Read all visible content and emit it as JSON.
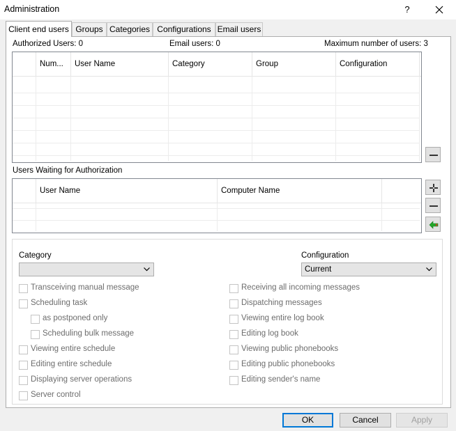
{
  "window": {
    "title": "Administration",
    "help_label": "?"
  },
  "tabs": [
    {
      "label": "Client end users",
      "active": true
    },
    {
      "label": "Groups",
      "active": false
    },
    {
      "label": "Categories",
      "active": false
    },
    {
      "label": "Configurations",
      "active": false
    },
    {
      "label": "Email users",
      "active": false
    }
  ],
  "stats": {
    "authorized_users": "Authorized Users: 0",
    "email_users": "Email users: 0",
    "max_users": "Maximum number of users: 3"
  },
  "users_table": {
    "columns": [
      "Num...",
      "User Name",
      "Category",
      "Group",
      "Configuration"
    ],
    "rows": []
  },
  "waiting": {
    "title": "Users Waiting for Authorization",
    "columns": [
      "User Name",
      "Computer Name"
    ],
    "rows": []
  },
  "options": {
    "category_label": "Category",
    "category_value": "",
    "configuration_label": "Configuration",
    "configuration_value": "Current",
    "left_checks": [
      {
        "label": "Transceiving manual message",
        "checked": false
      },
      {
        "label": "Scheduling task",
        "checked": false
      },
      {
        "label": "as postponed only",
        "checked": false
      },
      {
        "label": "Scheduling bulk message",
        "checked": false
      },
      {
        "label": "Viewing entire schedule",
        "checked": false
      },
      {
        "label": "Editing entire schedule",
        "checked": false
      },
      {
        "label": "Displaying server operations",
        "checked": false
      },
      {
        "label": "Server control",
        "checked": false
      }
    ],
    "right_checks": [
      {
        "label": "Receiving all incoming messages",
        "checked": false
      },
      {
        "label": "Dispatching messages",
        "checked": false
      },
      {
        "label": "Viewing entire log book",
        "checked": false
      },
      {
        "label": "Editing log book",
        "checked": false
      },
      {
        "label": "Viewing public phonebooks",
        "checked": false
      },
      {
        "label": "Editing public phonebooks",
        "checked": false
      },
      {
        "label": "Editing sender's name",
        "checked": false
      }
    ]
  },
  "buttons": {
    "ok": "OK",
    "cancel": "Cancel",
    "apply": "Apply"
  },
  "colors": {
    "accent": "#0078d7",
    "arrow_green": "#22a829",
    "arrow_red": "#d43a2a"
  },
  "icons": {
    "remove_user": "minus-icon",
    "add_user": "add-user-icon",
    "remove_waiting": "minus-icon",
    "transfer": "transfer-arrows-icon",
    "close": "close-icon",
    "dropdown": "chevron-down-icon"
  }
}
